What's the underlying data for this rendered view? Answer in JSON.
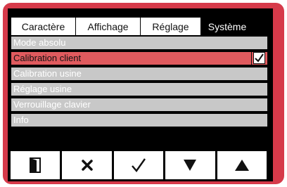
{
  "tabs": [
    {
      "label": "Caractère",
      "active": false
    },
    {
      "label": "Affichage",
      "active": false
    },
    {
      "label": "Réglage",
      "active": false
    },
    {
      "label": "Système",
      "active": true
    }
  ],
  "menu": {
    "items": [
      {
        "label": "Mode absolu",
        "selected": false
      },
      {
        "label": "Calibration client",
        "selected": true,
        "checked": true
      },
      {
        "label": "Calibration usine",
        "selected": false
      },
      {
        "label": "Réglage usine",
        "selected": false
      },
      {
        "label": "Verrouillage clavier",
        "selected": false
      },
      {
        "label": "Info",
        "selected": false
      }
    ]
  },
  "buttons": [
    {
      "name": "exit",
      "icon": "door-exit-icon"
    },
    {
      "name": "cancel",
      "icon": "close-icon"
    },
    {
      "name": "confirm",
      "icon": "checkmark-icon"
    },
    {
      "name": "down",
      "icon": "arrow-down-icon"
    },
    {
      "name": "up",
      "icon": "arrow-up-icon"
    }
  ],
  "colors": {
    "frame": "#d63a4a",
    "screen": "#000000",
    "row": "#c8c8c8",
    "row_selected": "#e05a5e"
  }
}
